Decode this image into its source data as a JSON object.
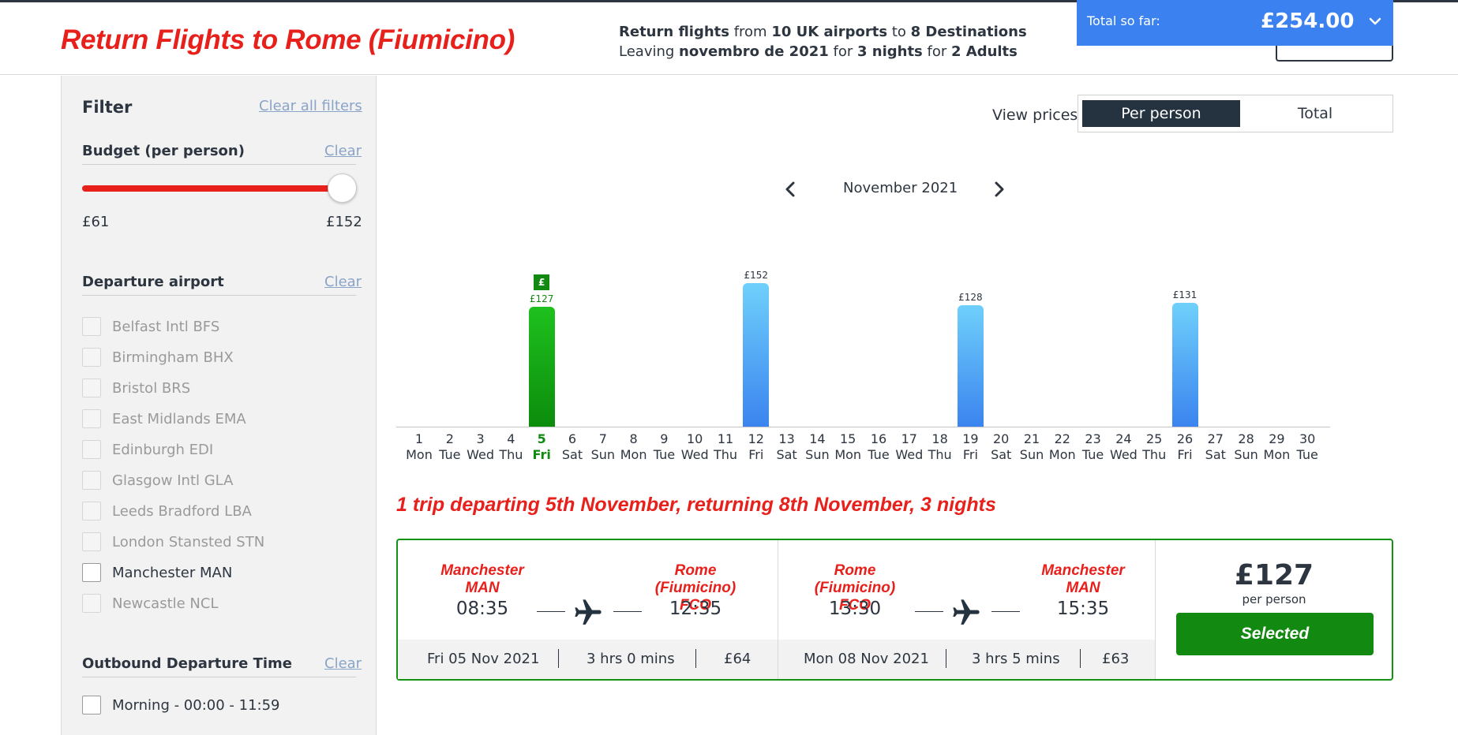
{
  "header": {
    "title": "Return Flights to Rome (Fiumicino)",
    "summary": {
      "l1_a": "Return flights",
      "l1_b": " from ",
      "l1_c": "10 UK airports",
      "l1_d": " to ",
      "l1_e": "8 Destinations",
      "l2_a": "Leaving ",
      "l2_b": "novembro de 2021",
      "l2_c": " for ",
      "l2_d": "3 nights",
      "l2_e": " for ",
      "l2_f": "2 Adults"
    },
    "total_label": "Total so far:",
    "total_value": "£254.00",
    "total_icon": "chevron-down-icon"
  },
  "filter": {
    "title": "Filter",
    "clear_all": "Clear all filters",
    "budget": {
      "title": "Budget (per person)",
      "clear": "Clear",
      "min": "£61",
      "max": "£152",
      "slider_value_fraction": 1.0
    },
    "departure": {
      "title": "Departure airport",
      "clear": "Clear",
      "airports": [
        {
          "label": "Belfast Intl BFS",
          "enabled": false
        },
        {
          "label": "Birmingham BHX",
          "enabled": false
        },
        {
          "label": "Bristol BRS",
          "enabled": false
        },
        {
          "label": "East Midlands EMA",
          "enabled": false
        },
        {
          "label": "Edinburgh EDI",
          "enabled": false
        },
        {
          "label": "Glasgow Intl GLA",
          "enabled": false
        },
        {
          "label": "Leeds Bradford LBA",
          "enabled": false
        },
        {
          "label": "London Stansted STN",
          "enabled": false
        },
        {
          "label": "Manchester MAN",
          "enabled": true
        },
        {
          "label": "Newcastle NCL",
          "enabled": false
        }
      ]
    },
    "outbound_time": {
      "title": "Outbound Departure Time",
      "clear": "Clear",
      "options": [
        "Morning - 00:00 - 11:59"
      ]
    }
  },
  "view_prices": {
    "label": "View prices",
    "per_person": "Per person",
    "total": "Total",
    "selected": "Per person"
  },
  "calendar": {
    "month": "November 2021",
    "prev_icon": "chevron-left-icon",
    "next_icon": "chevron-right-icon"
  },
  "chart_data": {
    "type": "bar",
    "title": "",
    "x": [
      1,
      2,
      3,
      4,
      5,
      6,
      7,
      8,
      9,
      10,
      11,
      12,
      13,
      14,
      15,
      16,
      17,
      18,
      19,
      20,
      21,
      22,
      23,
      24,
      25,
      26,
      27,
      28,
      29,
      30
    ],
    "weekdays": [
      "Mon",
      "Tue",
      "Wed",
      "Thu",
      "Fri",
      "Sat",
      "Sun",
      "Mon",
      "Tue",
      "Wed",
      "Thu",
      "Fri",
      "Sat",
      "Sun",
      "Mon",
      "Tue",
      "Wed",
      "Thu",
      "Fri",
      "Sat",
      "Sun",
      "Mon",
      "Tue",
      "Wed",
      "Thu",
      "Fri",
      "Sat",
      "Sun",
      "Mon",
      "Tue"
    ],
    "bars": [
      {
        "day": 5,
        "value": 127,
        "label": "£127",
        "selected": true
      },
      {
        "day": 12,
        "value": 152,
        "label": "£152",
        "selected": false
      },
      {
        "day": 19,
        "value": 128,
        "label": "£128",
        "selected": false
      },
      {
        "day": 26,
        "value": 131,
        "label": "£131",
        "selected": false
      }
    ],
    "selected_badge": "£",
    "colors": {
      "selected": "#128a12",
      "default": "#3b84ef"
    }
  },
  "trip": {
    "heading": "1 trip departing 5th November, returning 8th November, 3 nights",
    "outbound": {
      "from_city": "Manchester",
      "from_code": "MAN",
      "from_time": "08:35",
      "to_city": "Rome (Fiumicino)",
      "to_code": "FCO",
      "to_time": "12:35",
      "date": "Fri 05 Nov 2021",
      "duration": "3 hrs 0 mins",
      "price": "£64",
      "icon": "plane-icon"
    },
    "return": {
      "from_city": "Rome (Fiumicino)",
      "from_code": "FCO",
      "from_time": "13:30",
      "to_city": "Manchester",
      "to_code": "MAN",
      "to_time": "15:35",
      "date": "Mon 08 Nov 2021",
      "duration": "3 hrs 5 mins",
      "price": "£63",
      "icon": "plane-icon"
    },
    "price": "£127",
    "price_unit": "per person",
    "selected_label": "Selected"
  },
  "colors": {
    "brand_red": "#e8201c",
    "total_blue": "#3b82f0",
    "selected_green": "#128a12",
    "dark": "#25323f"
  }
}
